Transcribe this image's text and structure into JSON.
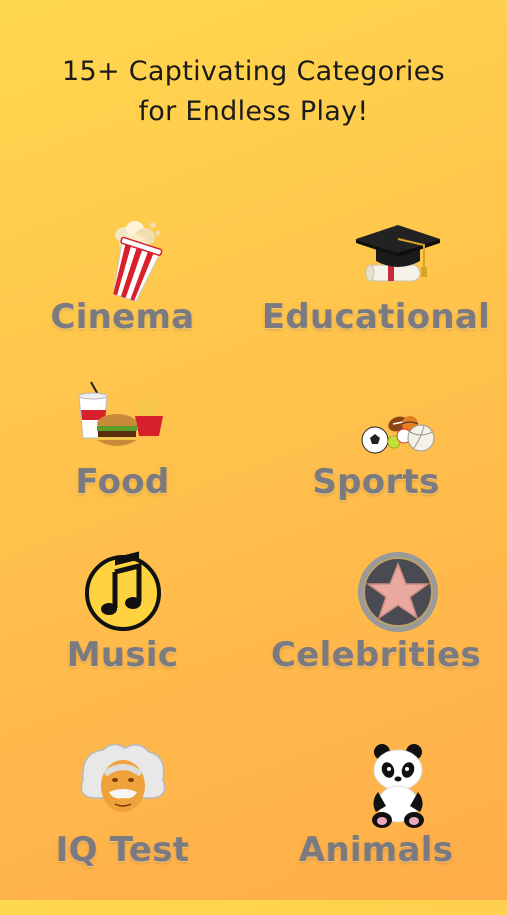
{
  "header": {
    "line1": "15+ Captivating Categories",
    "line2": "for Endless Play!"
  },
  "categories": [
    {
      "label": "Cinema",
      "icon": "popcorn-icon"
    },
    {
      "label": "Educational",
      "icon": "graduation-cap-icon"
    },
    {
      "label": "Food",
      "icon": "fast-food-icon"
    },
    {
      "label": "Sports",
      "icon": "sports-balls-icon"
    },
    {
      "label": "Music",
      "icon": "music-note-icon"
    },
    {
      "label": "Celebrities",
      "icon": "star-icon"
    },
    {
      "label": "IQ Test",
      "icon": "einstein-icon"
    },
    {
      "label": "Animals",
      "icon": "panda-icon"
    }
  ],
  "colors": {
    "background_top": "#ffd84e",
    "background_bottom": "#ffad4a",
    "label": "#7a7a80",
    "headline": "#1b1b1b"
  }
}
